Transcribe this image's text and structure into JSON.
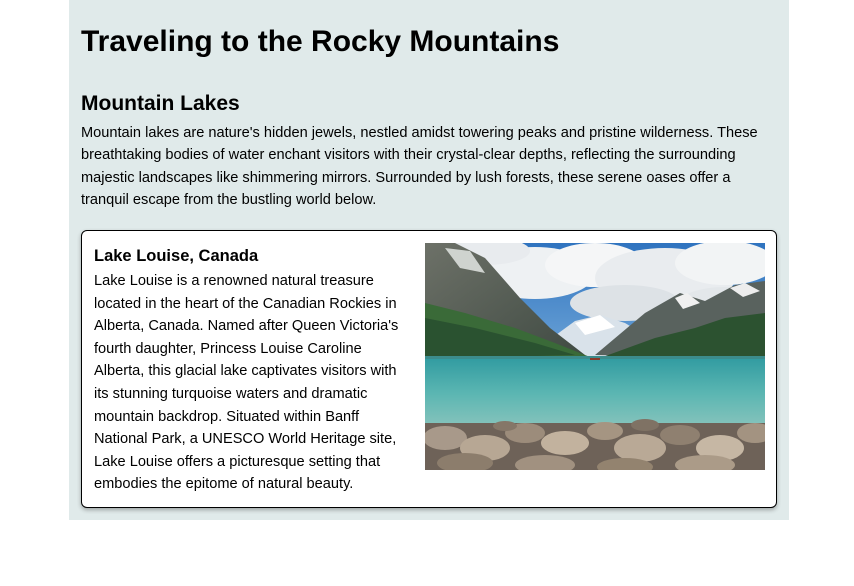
{
  "page": {
    "title": "Traveling to the Rocky Mountains"
  },
  "section": {
    "title": "Mountain Lakes",
    "intro": "Mountain lakes are nature's hidden jewels, nestled amidst towering peaks and pristine wilderness. These breathtaking bodies of water enchant visitors with their crystal-clear depths, reflecting the surrounding majestic landscapes like shimmering mirrors. Surrounded by lush forests, these serene oases offer a tranquil escape from the bustling world below."
  },
  "card": {
    "title": "Lake Louise, Canada",
    "description": "Lake Louise is a renowned natural treasure located in the heart of the Canadian Rockies in Alberta, Canada. Named after Queen Victoria's fourth daughter, Princess Louise Caroline Alberta, this glacial lake captivates visitors with its stunning turquoise waters and dramatic mountain backdrop. Situated within Banff National Park, a UNESCO World Heritage site, Lake Louise offers a picturesque setting that embodies the epitome of natural beauty."
  },
  "colors": {
    "page_background": "#e0eaea",
    "card_background": "#ffffff",
    "lake": "#4aa9a8",
    "sky": "#3b7fc4",
    "forest": "#2f5a34"
  }
}
